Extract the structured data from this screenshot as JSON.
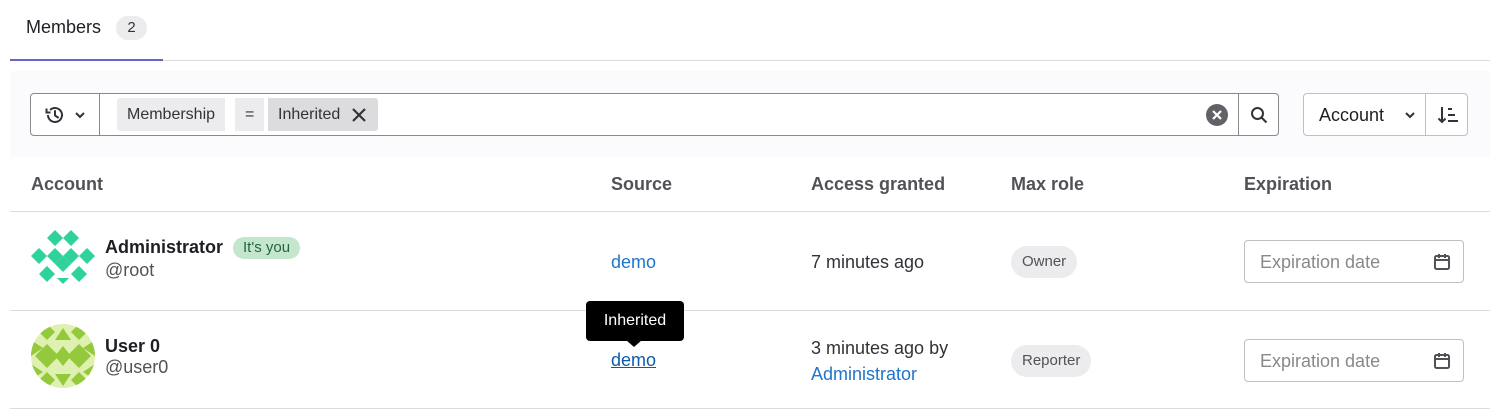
{
  "tabs": [
    {
      "label": "Members",
      "count": "2"
    }
  ],
  "filter": {
    "token": {
      "key": "Membership",
      "operator": "=",
      "value": "Inherited"
    }
  },
  "sort": {
    "field": "Account"
  },
  "table": {
    "headers": [
      "Account",
      "Source",
      "Access granted",
      "Max role",
      "Expiration"
    ],
    "rows": [
      {
        "name": "Administrator",
        "badge": "It's you",
        "username": "@root",
        "source": "demo",
        "access_granted": "7 minutes ago",
        "access_by": "",
        "max_role": "Owner",
        "expiration_placeholder": "Expiration date"
      },
      {
        "name": "User 0",
        "badge": "",
        "username": "@user0",
        "source": "demo",
        "access_granted": "3 minutes ago by",
        "access_by": "Administrator",
        "max_role": "Reporter",
        "expiration_placeholder": "Expiration date"
      }
    ]
  },
  "tooltip": {
    "text": "Inherited"
  },
  "colors": {
    "tab_accent": "#6666c4",
    "link": "#1f75cb",
    "you_badge_bg": "#c3e6cd"
  }
}
